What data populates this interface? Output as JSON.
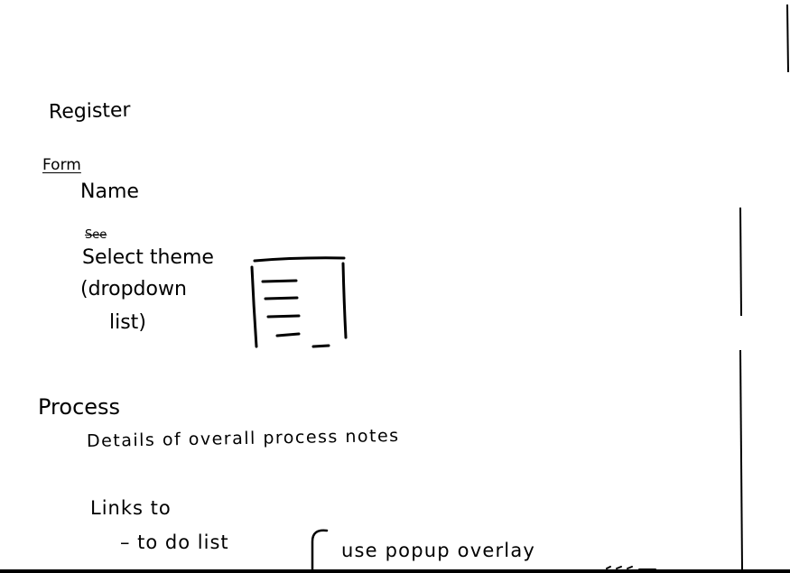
{
  "notes": {
    "register": "Register",
    "form": "Form",
    "name": "Name",
    "struck": "See",
    "select_theme": "Select theme",
    "dropdown_open": "(dropdown",
    "dropdown_close": "list)",
    "process": "Process",
    "details": "Details of overall process notes",
    "links_to": "Links to",
    "todo": "– to do list",
    "popup": "use popup overlay"
  },
  "ink_color": "#000000",
  "paper_color": "#ffffff"
}
